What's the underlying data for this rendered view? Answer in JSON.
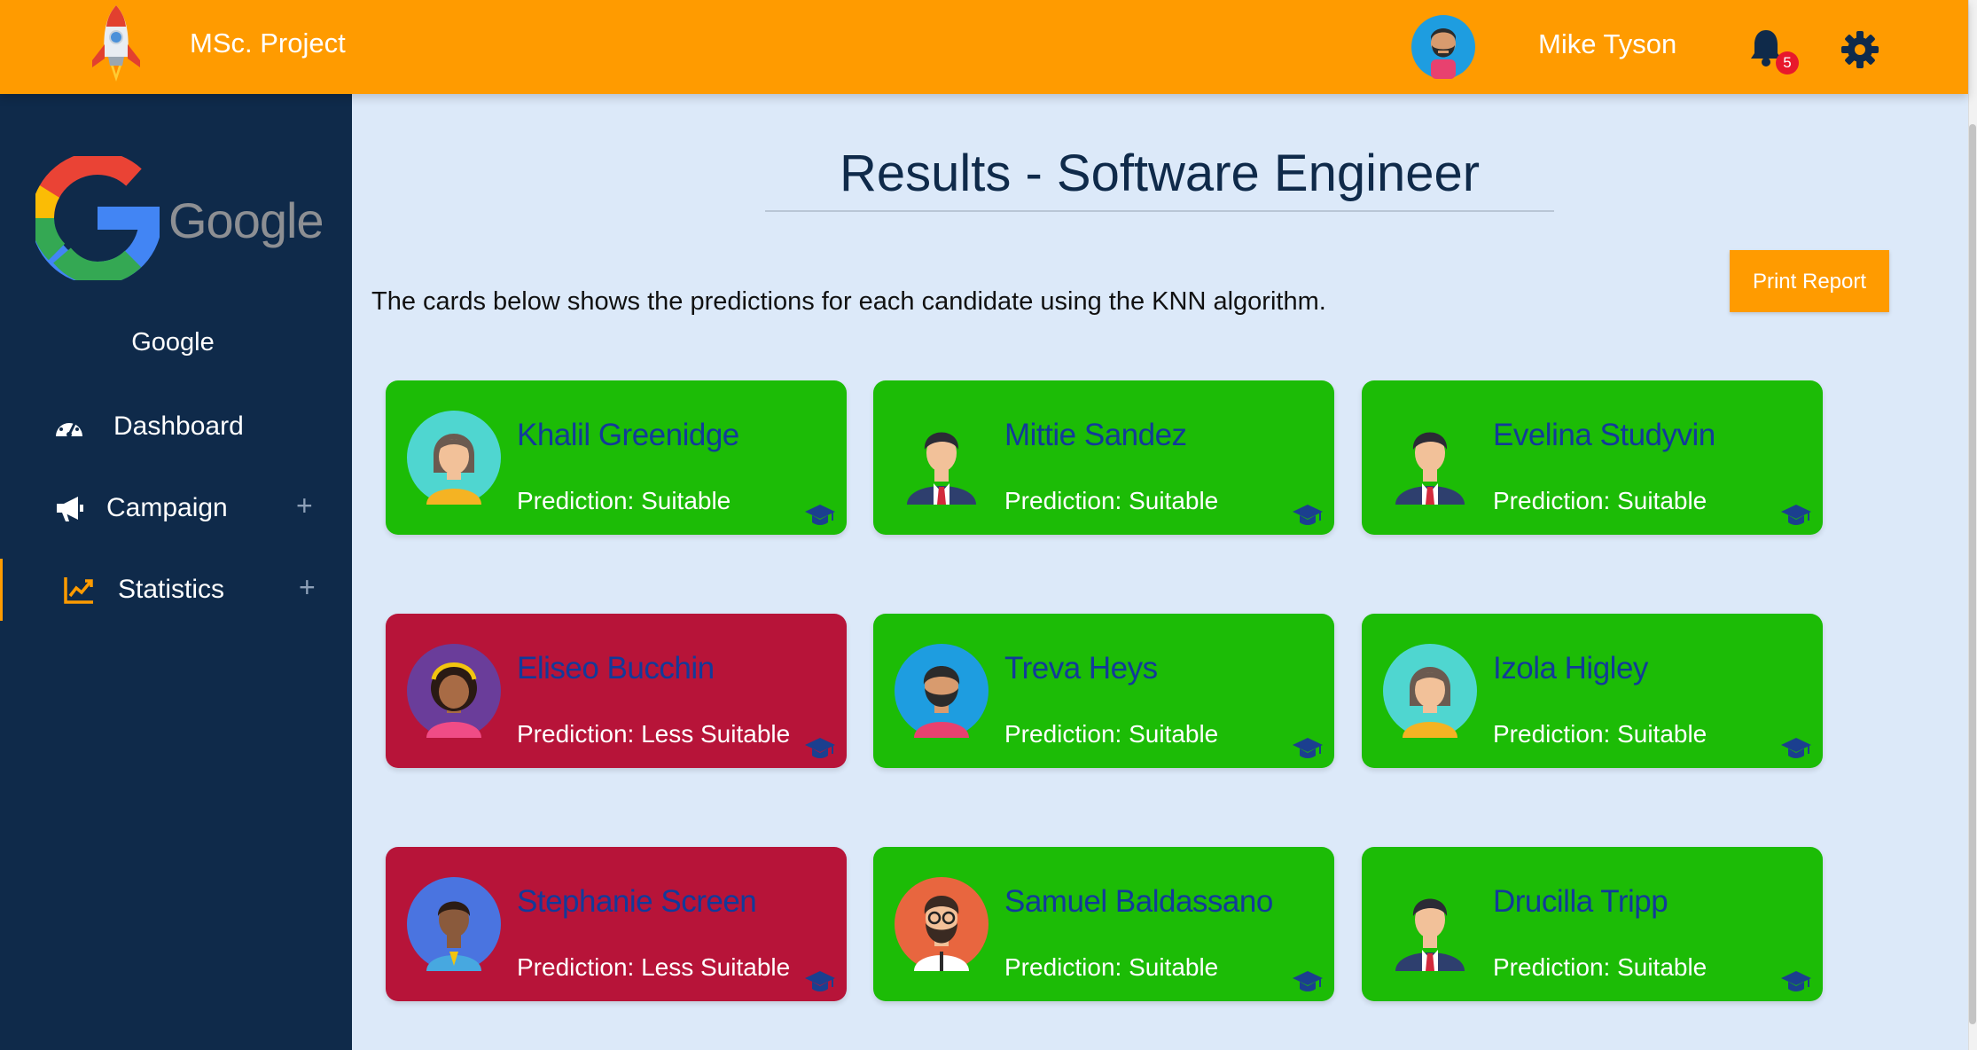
{
  "header": {
    "app_title": "MSc. Project",
    "user_name": "Mike Tyson",
    "notification_count": "5",
    "logo_icon": "rocket-icon",
    "accent_color": "#ff9b00"
  },
  "sidebar": {
    "company_logo_text": "Google",
    "company_name": "Google",
    "items": [
      {
        "label": "Dashboard",
        "icon": "dashboard-icon",
        "expandable": false,
        "active": false
      },
      {
        "label": "Campaign",
        "icon": "megaphone-icon",
        "expandable": true,
        "active": false,
        "toggle": "+"
      },
      {
        "label": "Statistics",
        "icon": "chart-line-icon",
        "expandable": true,
        "active": true,
        "toggle": "+"
      }
    ],
    "background_color": "#0f2a4a"
  },
  "main": {
    "title": "Results - Software Engineer",
    "description": "The cards below shows the predictions for each candidate using the KNN algorithm.",
    "print_button_label": "Print Report",
    "candidates": [
      {
        "name": "Khalil Greenidge",
        "prediction": "Prediction: Suitable",
        "status": "suitable"
      },
      {
        "name": "Mittie Sandez",
        "prediction": "Prediction: Suitable",
        "status": "suitable"
      },
      {
        "name": "Evelina Studyvin",
        "prediction": "Prediction: Suitable",
        "status": "suitable"
      },
      {
        "name": "Eliseo Bucchin",
        "prediction": "Prediction: Less Suitable",
        "status": "less"
      },
      {
        "name": "Treva Heys",
        "prediction": "Prediction: Suitable",
        "status": "suitable"
      },
      {
        "name": "Izola Higley",
        "prediction": "Prediction: Suitable",
        "status": "suitable"
      },
      {
        "name": "Stephanie Screen",
        "prediction": "Prediction: Less Suitable",
        "status": "less"
      },
      {
        "name": "Samuel Baldassano",
        "prediction": "Prediction: Suitable",
        "status": "suitable"
      },
      {
        "name": "Drucilla Tripp",
        "prediction": "Prediction: Suitable",
        "status": "suitable"
      }
    ],
    "suitable_color": "#1cbc06",
    "less_suitable_color": "#b71439"
  }
}
